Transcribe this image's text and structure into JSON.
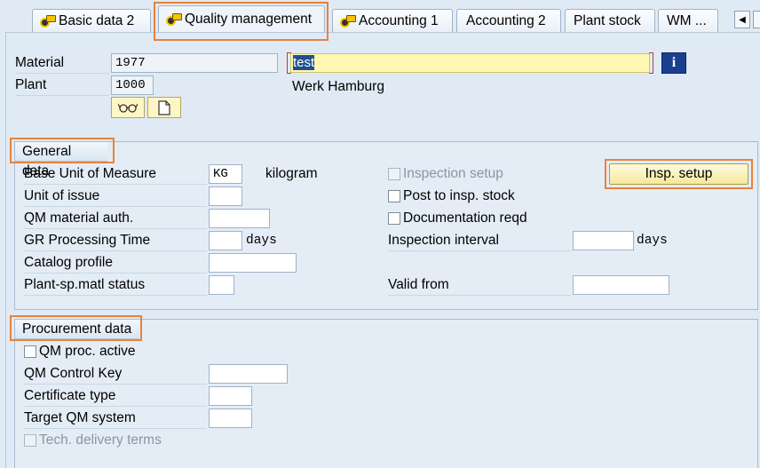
{
  "tabs": [
    {
      "label": "Basic data 2",
      "icon": "qm-view-icon"
    },
    {
      "label": "Quality management",
      "icon": "qm-view-icon"
    },
    {
      "label": "Accounting 1",
      "icon": "qm-view-icon"
    },
    {
      "label": "Accounting 2"
    },
    {
      "label": "Plant stock"
    },
    {
      "label": "WM ..."
    }
  ],
  "header": {
    "material_label": "Material",
    "material_value": "1977",
    "description_value": "test",
    "plant_label": "Plant",
    "plant_value": "1000",
    "plant_name": "Werk Hamburg",
    "info_glyph": "i"
  },
  "general": {
    "title": "General data",
    "base_uom_label": "Base Unit of Measure",
    "base_uom_value": "KG",
    "base_uom_text": "kilogram",
    "unit_issue_label": "Unit of issue",
    "qm_auth_label": "QM material auth.",
    "gr_time_label": "GR Processing Time",
    "gr_time_unit": "days",
    "catalog_label": "Catalog profile",
    "plant_status_label": "Plant-sp.matl status",
    "insp_setup_chk_label": "Inspection setup",
    "post_insp_label": "Post to insp. stock",
    "doc_reqd_label": "Documentation reqd",
    "insp_interval_label": "Inspection interval",
    "insp_interval_unit": "days",
    "valid_from_label": "Valid from",
    "insp_setup_button": "Insp. setup"
  },
  "procurement": {
    "title": "Procurement data",
    "qm_proc_label": "QM proc. active",
    "control_key_label": "QM Control Key",
    "cert_type_label": "Certificate type",
    "target_qm_label": "Target QM system",
    "tech_terms_label": "Tech. delivery terms"
  },
  "colors": {
    "highlight": "#e8823a",
    "background": "#dfeaf5",
    "selection": "#1f4f8f",
    "required_field": "#fff8b3"
  }
}
